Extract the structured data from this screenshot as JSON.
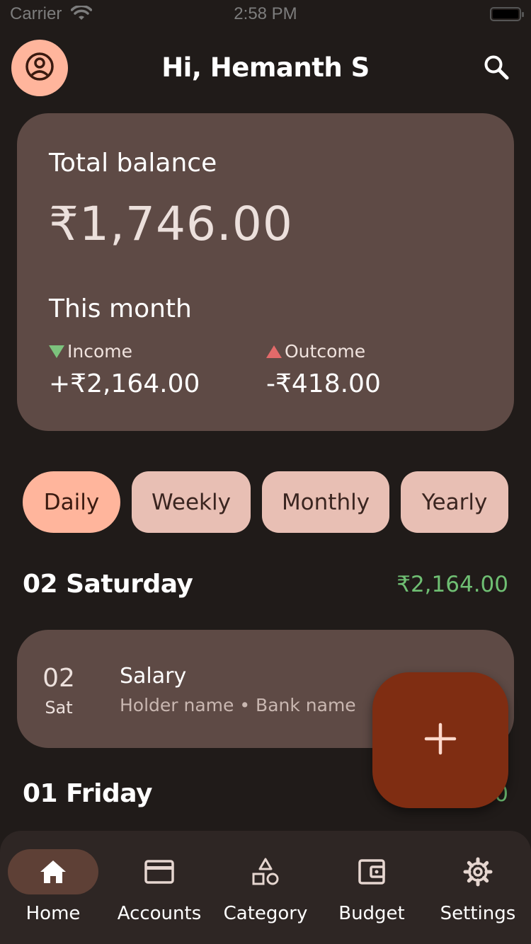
{
  "status_bar": {
    "carrier": "Carrier",
    "time": "2:58 PM"
  },
  "header": {
    "greeting": "Hi, Hemanth S",
    "profile_icon": "account-circle-icon",
    "search_icon": "search-icon"
  },
  "balance_card": {
    "title": "Total balance",
    "amount": "₹1,746.00",
    "month_title": "This month",
    "income_label": "Income",
    "income_value": "+₹2,164.00",
    "outcome_label": "Outcome",
    "outcome_value": "-₹418.00",
    "income_color": "#7cc37d",
    "outcome_color": "#e36a6a"
  },
  "filters": [
    {
      "label": "Daily",
      "selected": true
    },
    {
      "label": "Weekly",
      "selected": false
    },
    {
      "label": "Monthly",
      "selected": false
    },
    {
      "label": "Yearly",
      "selected": false
    }
  ],
  "days": [
    {
      "heading": "02 Saturday",
      "total": "₹2,164.00",
      "transactions": [
        {
          "day_num": "02",
          "day_name": "Sat",
          "title": "Salary",
          "subtitle": "Holder name • Bank name"
        }
      ]
    },
    {
      "heading": "01 Friday",
      "total": "0"
    }
  ],
  "fab": {
    "icon": "plus-icon"
  },
  "nav": [
    {
      "label": "Home",
      "icon": "home-icon",
      "active": true
    },
    {
      "label": "Accounts",
      "icon": "credit-card-icon",
      "active": false
    },
    {
      "label": "Category",
      "icon": "shapes-icon",
      "active": false
    },
    {
      "label": "Budget",
      "icon": "wallet-icon",
      "active": false
    },
    {
      "label": "Settings",
      "icon": "gear-icon",
      "active": false
    }
  ],
  "colors": {
    "background": "#201b19",
    "card": "#5e4a45",
    "accent": "#ffb59c",
    "chip": "#e8bfb4",
    "fab": "#7f2d12",
    "positive": "#6fbf73"
  }
}
